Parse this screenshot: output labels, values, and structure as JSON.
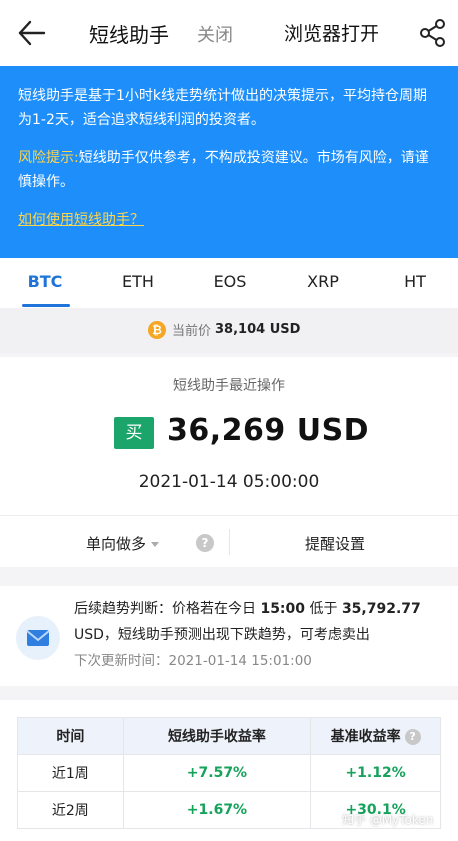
{
  "header": {
    "back_icon": "arrow-left-icon",
    "title": "短线助手",
    "close_label": "关闭",
    "open_browser_label": "浏览器打开",
    "share_icon": "share-icon"
  },
  "banner": {
    "description": "短线助手是基于1小时k线走势统计做出的决策提示，平均持仓周期为1-2天，适合追求短线利润的投资者。",
    "risk_label": "风险提示:",
    "risk_text": "短线助手仅供参考，不构成投资建议。市场有风险，请谨慎操作。",
    "howto_link": "如何使用短线助手？",
    "bg_color": "#1e8ffa",
    "highlight_color": "#ffd54a"
  },
  "tabs": [
    {
      "label": "BTC",
      "active": true
    },
    {
      "label": "ETH",
      "active": false
    },
    {
      "label": "EOS",
      "active": false
    },
    {
      "label": "XRP",
      "active": false
    },
    {
      "label": "HT",
      "active": false
    }
  ],
  "current_price": {
    "coin_icon": "bitcoin-icon",
    "coin_symbol": "₿",
    "label": "当前价",
    "value": "38,104 USD"
  },
  "recent_operation": {
    "title": "短线助手最近操作",
    "action": "买",
    "price": "36,269 USD",
    "time": "2021-01-14 05:00:00",
    "action_color": "#1ca56a"
  },
  "controls": {
    "mode_label": "单向做多",
    "help_symbol": "?",
    "alert_settings_label": "提醒设置"
  },
  "trend": {
    "icon": "mail-icon",
    "prefix": "后续趋势判断：价格若在今日",
    "time_bold": "15:00",
    "middle": "低于",
    "price_bold": "35,792.77",
    "suffix": "USD，短线助手预测出现下跌趋势，可考虑卖出",
    "next_update_label": "下次更新时间：",
    "next_update_time": "2021-01-14 15:01:00"
  },
  "returns_table": {
    "headers": [
      "时间",
      "短线助手收益率",
      "基准收益率"
    ],
    "help_symbol": "?",
    "rows": [
      [
        "近1周",
        "+7.57%",
        "+1.12%"
      ],
      [
        "近2周",
        "+1.67%",
        "+30.1%"
      ]
    ],
    "positive_color": "#16a25b"
  },
  "watermark": "知乎 @MyToken"
}
